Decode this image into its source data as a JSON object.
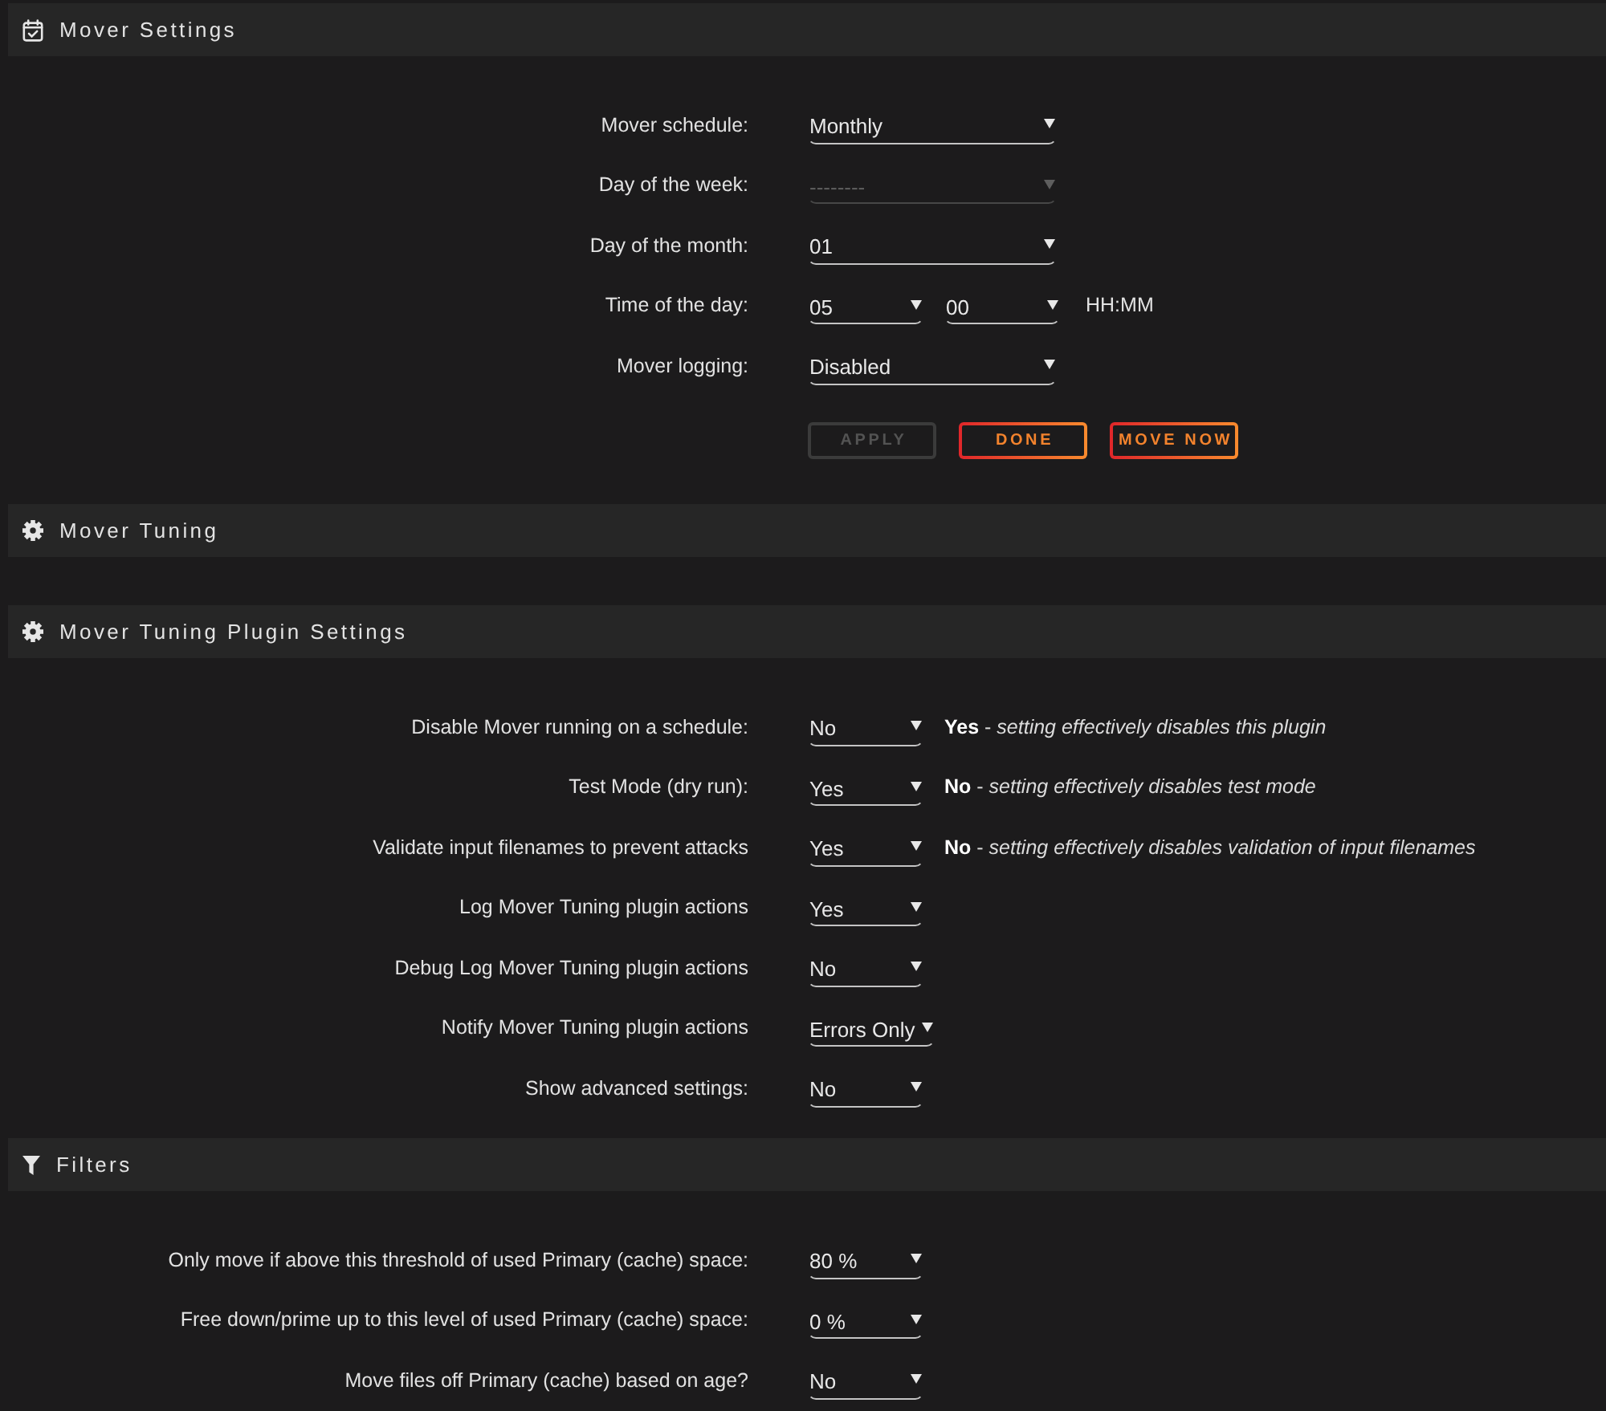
{
  "sections": [
    {
      "kind": "schedule",
      "title": "Mover Settings",
      "rows": [
        {
          "kind": "select",
          "label": "Mover schedule:",
          "value": "Monthly",
          "disabled": false
        },
        {
          "kind": "select",
          "label": "Day of the week:",
          "value": "--------",
          "disabled": true
        },
        {
          "kind": "select",
          "label": "Day of the month:",
          "value": "01",
          "disabled": false
        },
        {
          "kind": "time",
          "label": "Time of the day:",
          "fields": [
            {
              "value": "05"
            },
            {
              "value": "00"
            }
          ],
          "suffix": "HH:MM"
        },
        {
          "kind": "select",
          "label": "Mover logging:",
          "value": "Disabled",
          "disabled": false
        }
      ],
      "buttons": [
        {
          "label": "APPLY",
          "disabled": true
        },
        {
          "label": "DONE",
          "disabled": false
        },
        {
          "label": "MOVE NOW",
          "disabled": false
        }
      ]
    },
    {
      "kind": "tuning",
      "title": "Mover Tuning"
    },
    {
      "kind": "tuning",
      "title": "Mover Tuning Plugin Settings",
      "rows": [
        {
          "kind": "select",
          "label": "Disable Mover running on a schedule:",
          "value": "No",
          "note": "**Yes** - *setting effectively disables this plugin*"
        },
        {
          "kind": "select",
          "label": "Test Mode (dry run):",
          "value": "Yes",
          "note": "**No** - *setting effectively disables test mode*"
        },
        {
          "kind": "select",
          "label": "Validate input filenames to prevent attacks",
          "value": "Yes",
          "note": "**No** - *setting effectively disables validation of input filenames*"
        },
        {
          "kind": "select",
          "label": "Log Mover Tuning plugin actions",
          "value": "Yes"
        },
        {
          "kind": "select",
          "label": "Debug Log Mover Tuning plugin actions",
          "value": "No"
        },
        {
          "kind": "select",
          "label": "Notify Mover Tuning plugin actions",
          "value": "Errors Only"
        },
        {
          "kind": "select",
          "label": "Show advanced settings:",
          "value": "No"
        }
      ]
    },
    {
      "kind": "filters",
      "title": "Filters",
      "rows": [
        {
          "kind": "select",
          "label": "Only move if above this threshold of used Primary (cache) space:",
          "value": "80 %"
        },
        {
          "kind": "select",
          "label": "Free down/prime up to this level of used Primary (cache) space:",
          "value": "0 %"
        },
        {
          "kind": "select",
          "label": "Move files off Primary (cache) based on age?",
          "value": "No"
        }
      ]
    }
  ]
}
